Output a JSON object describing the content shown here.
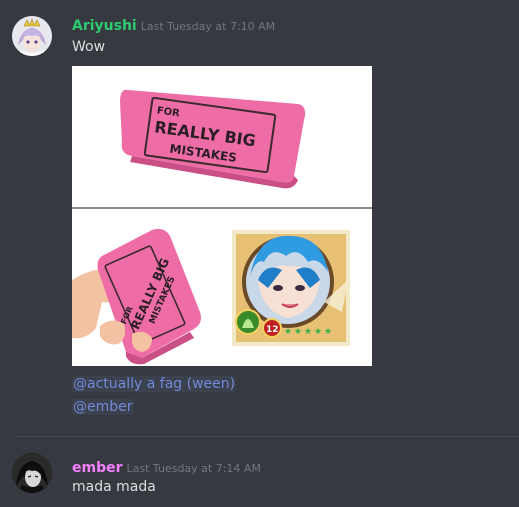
{
  "messages": [
    {
      "username": "Ariyushi",
      "username_color": "#2ecc71",
      "timestamp": "Last Tuesday at 7:10 AM",
      "text": "Wow",
      "avatar_icon": "anime-avatar-crown",
      "attachment": {
        "top_caption": [
          "FOR",
          "REALLY BIG",
          "MISTAKES"
        ],
        "bottom_caption": [
          "FOR",
          "REALLY BIG",
          "MISTAKES"
        ],
        "badge_level": "12"
      },
      "mentions": [
        "@actually a fag (ween)",
        "@ember"
      ]
    },
    {
      "username": "ember",
      "username_color": "#f47fff",
      "timestamp": "Last Tuesday at 7:14 AM",
      "text": "mada mada",
      "avatar_icon": "dark-anime-avatar"
    }
  ]
}
